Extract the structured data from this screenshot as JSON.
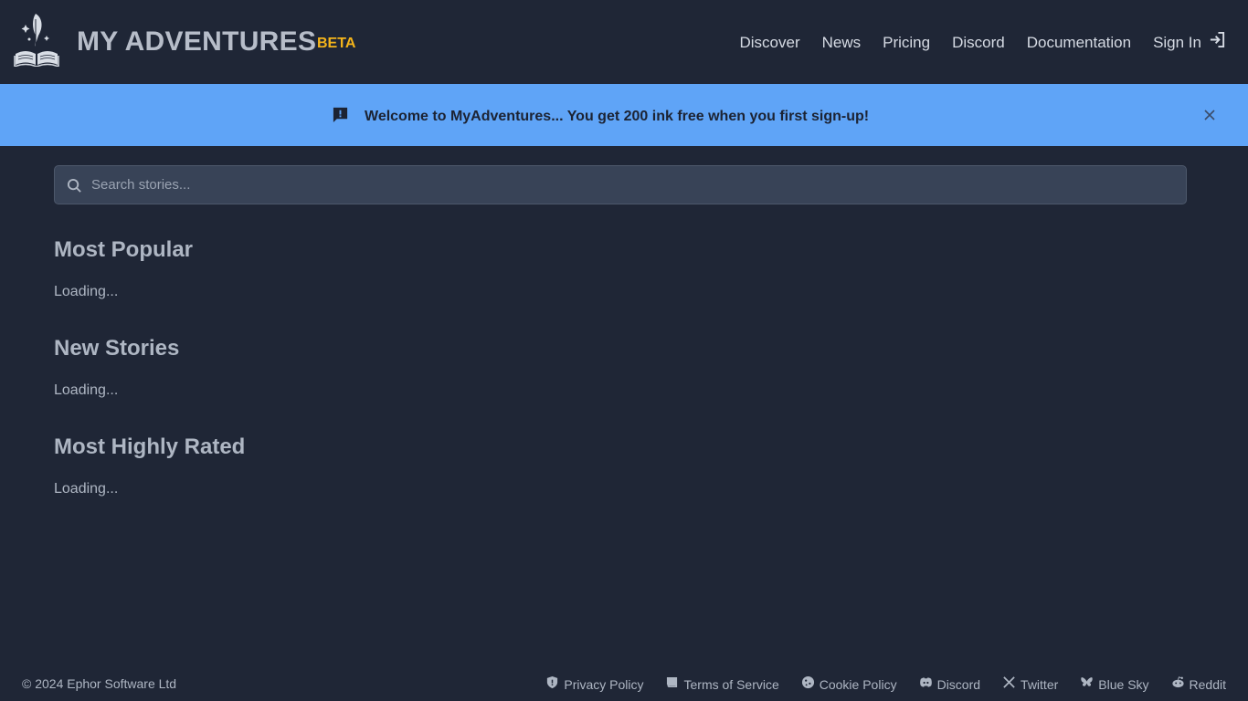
{
  "header": {
    "brand": "MY ADVENTURES",
    "badge": "BETA",
    "nav": [
      "Discover",
      "News",
      "Pricing",
      "Discord",
      "Documentation"
    ],
    "signin_label": "Sign In"
  },
  "banner": {
    "text": "Welcome to MyAdventures... You get 200 ink free when you first sign-up!"
  },
  "search": {
    "placeholder": "Search stories..."
  },
  "sections": [
    {
      "title": "Most Popular",
      "status": "Loading..."
    },
    {
      "title": "New Stories",
      "status": "Loading..."
    },
    {
      "title": "Most Highly Rated",
      "status": "Loading..."
    }
  ],
  "footer": {
    "copyright": "© 2024 Ephor Software Ltd",
    "links": [
      "Privacy Policy",
      "Terms of Service",
      "Cookie Policy",
      "Discord",
      "Twitter",
      "Blue Sky",
      "Reddit"
    ]
  },
  "colors": {
    "background": "#1f2636",
    "banner": "#5fa4f7",
    "badge": "#f4b41a",
    "search_bg": "#384357"
  },
  "icons": {
    "logo": "book-quill-logo",
    "signin": "sign-in-icon",
    "banner": "alert-message-icon",
    "close": "close-icon",
    "search": "search-icon",
    "footer": [
      "shield-icon",
      "scroll-icon",
      "cookie-icon",
      "discord-icon",
      "x-icon",
      "butterfly-icon",
      "reddit-icon"
    ]
  }
}
